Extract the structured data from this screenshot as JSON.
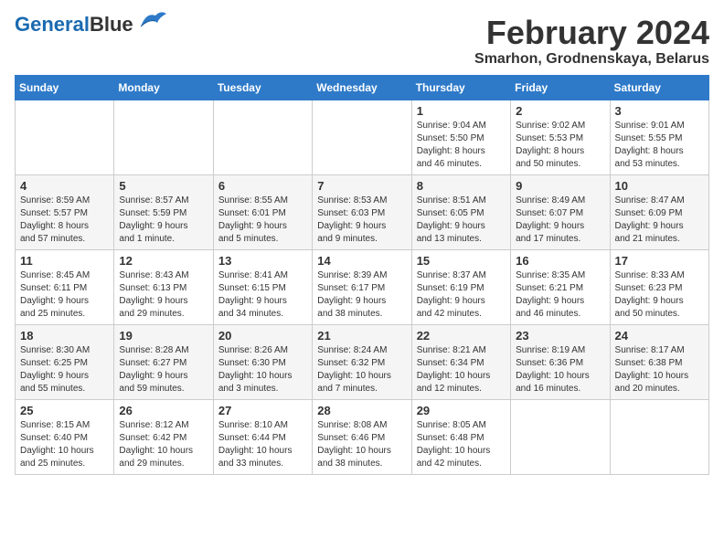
{
  "header": {
    "logo_line1": "General",
    "logo_line2": "Blue",
    "main_title": "February 2024",
    "subtitle": "Smarhon, Grodnenskaya, Belarus"
  },
  "days_of_week": [
    "Sunday",
    "Monday",
    "Tuesday",
    "Wednesday",
    "Thursday",
    "Friday",
    "Saturday"
  ],
  "weeks": [
    [
      {
        "day": "",
        "info": ""
      },
      {
        "day": "",
        "info": ""
      },
      {
        "day": "",
        "info": ""
      },
      {
        "day": "",
        "info": ""
      },
      {
        "day": "1",
        "info": "Sunrise: 9:04 AM\nSunset: 5:50 PM\nDaylight: 8 hours\nand 46 minutes."
      },
      {
        "day": "2",
        "info": "Sunrise: 9:02 AM\nSunset: 5:53 PM\nDaylight: 8 hours\nand 50 minutes."
      },
      {
        "day": "3",
        "info": "Sunrise: 9:01 AM\nSunset: 5:55 PM\nDaylight: 8 hours\nand 53 minutes."
      }
    ],
    [
      {
        "day": "4",
        "info": "Sunrise: 8:59 AM\nSunset: 5:57 PM\nDaylight: 8 hours\nand 57 minutes."
      },
      {
        "day": "5",
        "info": "Sunrise: 8:57 AM\nSunset: 5:59 PM\nDaylight: 9 hours\nand 1 minute."
      },
      {
        "day": "6",
        "info": "Sunrise: 8:55 AM\nSunset: 6:01 PM\nDaylight: 9 hours\nand 5 minutes."
      },
      {
        "day": "7",
        "info": "Sunrise: 8:53 AM\nSunset: 6:03 PM\nDaylight: 9 hours\nand 9 minutes."
      },
      {
        "day": "8",
        "info": "Sunrise: 8:51 AM\nSunset: 6:05 PM\nDaylight: 9 hours\nand 13 minutes."
      },
      {
        "day": "9",
        "info": "Sunrise: 8:49 AM\nSunset: 6:07 PM\nDaylight: 9 hours\nand 17 minutes."
      },
      {
        "day": "10",
        "info": "Sunrise: 8:47 AM\nSunset: 6:09 PM\nDaylight: 9 hours\nand 21 minutes."
      }
    ],
    [
      {
        "day": "11",
        "info": "Sunrise: 8:45 AM\nSunset: 6:11 PM\nDaylight: 9 hours\nand 25 minutes."
      },
      {
        "day": "12",
        "info": "Sunrise: 8:43 AM\nSunset: 6:13 PM\nDaylight: 9 hours\nand 29 minutes."
      },
      {
        "day": "13",
        "info": "Sunrise: 8:41 AM\nSunset: 6:15 PM\nDaylight: 9 hours\nand 34 minutes."
      },
      {
        "day": "14",
        "info": "Sunrise: 8:39 AM\nSunset: 6:17 PM\nDaylight: 9 hours\nand 38 minutes."
      },
      {
        "day": "15",
        "info": "Sunrise: 8:37 AM\nSunset: 6:19 PM\nDaylight: 9 hours\nand 42 minutes."
      },
      {
        "day": "16",
        "info": "Sunrise: 8:35 AM\nSunset: 6:21 PM\nDaylight: 9 hours\nand 46 minutes."
      },
      {
        "day": "17",
        "info": "Sunrise: 8:33 AM\nSunset: 6:23 PM\nDaylight: 9 hours\nand 50 minutes."
      }
    ],
    [
      {
        "day": "18",
        "info": "Sunrise: 8:30 AM\nSunset: 6:25 PM\nDaylight: 9 hours\nand 55 minutes."
      },
      {
        "day": "19",
        "info": "Sunrise: 8:28 AM\nSunset: 6:27 PM\nDaylight: 9 hours\nand 59 minutes."
      },
      {
        "day": "20",
        "info": "Sunrise: 8:26 AM\nSunset: 6:30 PM\nDaylight: 10 hours\nand 3 minutes."
      },
      {
        "day": "21",
        "info": "Sunrise: 8:24 AM\nSunset: 6:32 PM\nDaylight: 10 hours\nand 7 minutes."
      },
      {
        "day": "22",
        "info": "Sunrise: 8:21 AM\nSunset: 6:34 PM\nDaylight: 10 hours\nand 12 minutes."
      },
      {
        "day": "23",
        "info": "Sunrise: 8:19 AM\nSunset: 6:36 PM\nDaylight: 10 hours\nand 16 minutes."
      },
      {
        "day": "24",
        "info": "Sunrise: 8:17 AM\nSunset: 6:38 PM\nDaylight: 10 hours\nand 20 minutes."
      }
    ],
    [
      {
        "day": "25",
        "info": "Sunrise: 8:15 AM\nSunset: 6:40 PM\nDaylight: 10 hours\nand 25 minutes."
      },
      {
        "day": "26",
        "info": "Sunrise: 8:12 AM\nSunset: 6:42 PM\nDaylight: 10 hours\nand 29 minutes."
      },
      {
        "day": "27",
        "info": "Sunrise: 8:10 AM\nSunset: 6:44 PM\nDaylight: 10 hours\nand 33 minutes."
      },
      {
        "day": "28",
        "info": "Sunrise: 8:08 AM\nSunset: 6:46 PM\nDaylight: 10 hours\nand 38 minutes."
      },
      {
        "day": "29",
        "info": "Sunrise: 8:05 AM\nSunset: 6:48 PM\nDaylight: 10 hours\nand 42 minutes."
      },
      {
        "day": "",
        "info": ""
      },
      {
        "day": "",
        "info": ""
      }
    ]
  ]
}
